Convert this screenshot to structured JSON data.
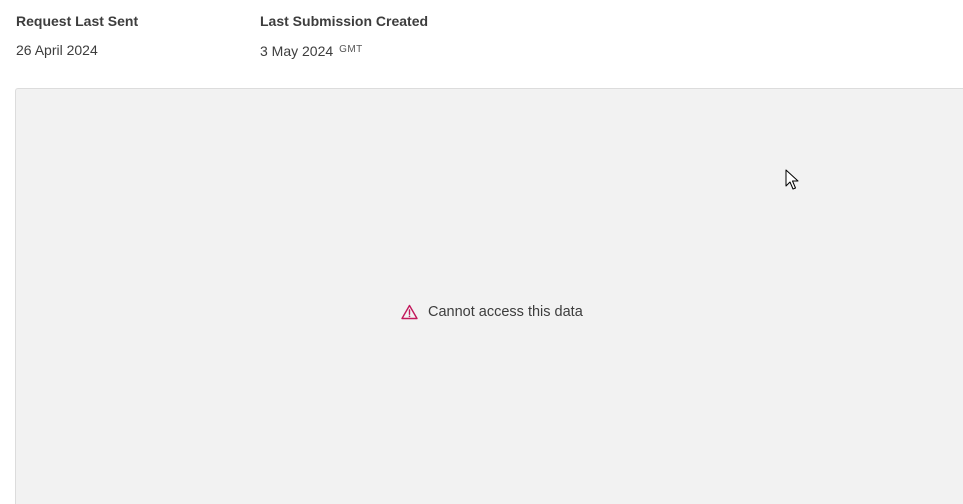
{
  "fields": {
    "request_last_sent": {
      "label": "Request Last Sent",
      "value": "26 April 2024"
    },
    "last_submission_created": {
      "label": "Last Submission Created",
      "value": "3 May 2024",
      "timezone": "GMT"
    }
  },
  "panel": {
    "message": "Cannot access this data",
    "icon": "warning-triangle-icon",
    "icon_color": "#c2185b",
    "background": "#f2f2f2"
  }
}
